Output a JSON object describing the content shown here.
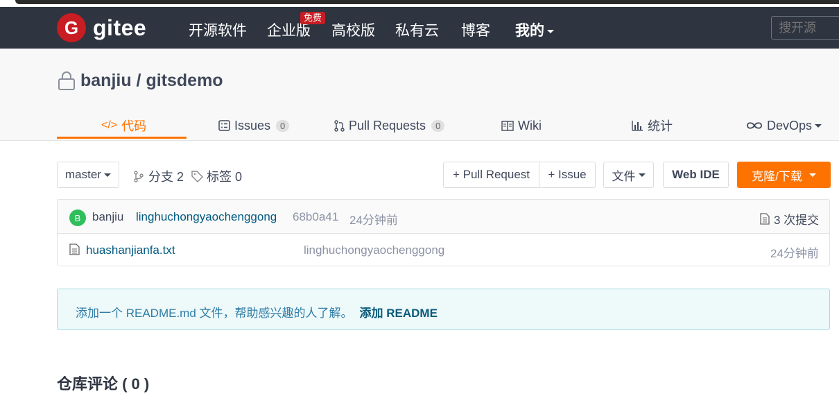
{
  "nav": {
    "logo_text": "gitee",
    "items": [
      "开源软件",
      "企业版",
      "高校版",
      "私有云",
      "博客",
      "我的"
    ],
    "free_badge": "免费",
    "search_placeholder": "搜开源"
  },
  "repo": {
    "title": "banjiu / gitsdemo",
    "tabs": [
      {
        "icon": "</>",
        "label": "代码"
      },
      {
        "label": "Issues",
        "count": "0"
      },
      {
        "label": "Pull Requests",
        "count": "0"
      },
      {
        "label": "Wiki"
      },
      {
        "label": "统计"
      },
      {
        "label": "DevOps"
      }
    ]
  },
  "toolbar": {
    "branch": "master",
    "branches": "分支 2",
    "tags": "标签 0",
    "pull_request": "+ Pull Request",
    "issue": "+ Issue",
    "file": "文件",
    "web_ide": "Web IDE",
    "clone": "克隆/下载"
  },
  "commit": {
    "avatar_letter": "B",
    "author": "banjiu",
    "message": "linghuchongyaochenggong",
    "hash": "68b0a41",
    "time": "24分钟前",
    "count": "3 次提交"
  },
  "files": [
    {
      "name": "huashanjianfa.txt",
      "message": "linghuchongyaochenggong",
      "time": "24分钟前"
    }
  ],
  "readme": {
    "text": "添加一个 README.md 文件，帮助感兴趣的人了解。",
    "link": "添加 README"
  },
  "comments_title": "仓库评论 ( 0 )",
  "colors": {
    "navbar": "#2e3440",
    "accent": "#fe7300",
    "brand": "#c71d23"
  }
}
